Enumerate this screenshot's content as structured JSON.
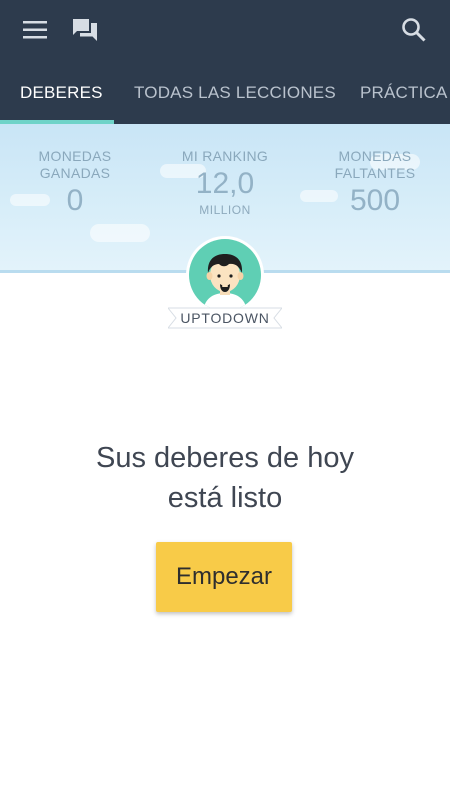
{
  "toolbar": {
    "icons": [
      "menu-icon",
      "chat-icon",
      "search-icon"
    ],
    "background": "#2d3b4d"
  },
  "tabs": [
    {
      "label": "DEBERES",
      "active": true
    },
    {
      "label": "TODAS LAS LECCIONES",
      "active": false
    },
    {
      "label": "PRÁCTICA",
      "active": false
    }
  ],
  "stats": {
    "coins_earned": {
      "label_line1": "MONEDAS",
      "label_line2": "GANADAS",
      "value": "0"
    },
    "ranking": {
      "label": "MI RANKING",
      "value": "12,0",
      "unit": "MILLION"
    },
    "coins_missing": {
      "label_line1": "MONEDAS",
      "label_line2": "FALTANTES",
      "value": "500"
    }
  },
  "profile": {
    "username": "UPTODOWN",
    "avatar_icon": "user-avatar-icon"
  },
  "homework": {
    "message_line1": "Sus deberes de hoy",
    "message_line2": "está listo",
    "start_label": "Empezar"
  },
  "colors": {
    "accent": "#6fd3c8",
    "button": "#f8cb48",
    "banner": "#d3ebf8"
  }
}
